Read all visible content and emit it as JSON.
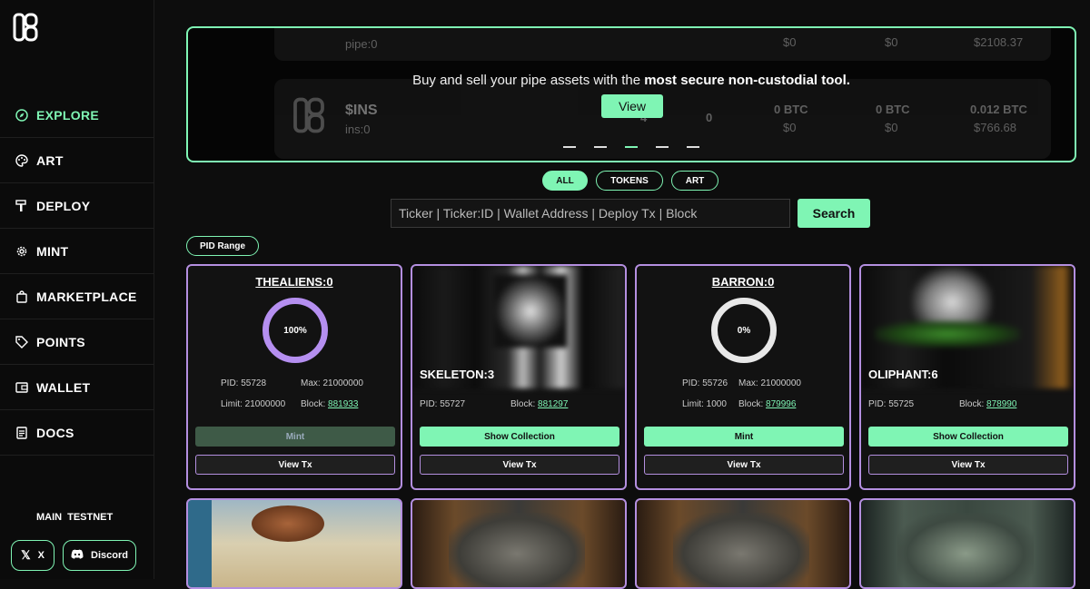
{
  "sidebar": {
    "items": [
      {
        "label": "EXPLORE",
        "icon": "compass-icon"
      },
      {
        "label": "ART",
        "icon": "palette-icon"
      },
      {
        "label": "DEPLOY",
        "icon": "hammer-icon"
      },
      {
        "label": "MINT",
        "icon": "gear-icon"
      },
      {
        "label": "MARKETPLACE",
        "icon": "shopping-bag-icon"
      },
      {
        "label": "POINTS",
        "icon": "tag-icon"
      },
      {
        "label": "WALLET",
        "icon": "wallet-icon"
      },
      {
        "label": "DOCS",
        "icon": "document-icon"
      }
    ],
    "network": {
      "main": "MAIN",
      "testnet": "TESTNET"
    },
    "social": {
      "x_label": "X",
      "discord_label": "Discord"
    }
  },
  "hero": {
    "text_plain": "Buy and sell your pipe assets with the ",
    "text_bold": "most secure non-custodial tool.",
    "button": "View",
    "ghost_top": {
      "sub": "pipe:0",
      "c1": "$0",
      "c2": "$0",
      "c3": "$2108.37"
    },
    "ghost_bottom": {
      "ticker": "$INS",
      "sub": "ins:0",
      "holders": "4",
      "count": "0",
      "v1": "0 BTC",
      "v1s": "$0",
      "v2": "0 BTC",
      "v2s": "$0",
      "v3": "0.012 BTC",
      "v3s": "$766.68"
    },
    "active_dot": 2,
    "dot_count": 5
  },
  "filters": {
    "all": "ALL",
    "tokens": "TOKENS",
    "art": "ART",
    "active": "ALL"
  },
  "search": {
    "placeholder": "Ticker | Ticker:ID | Wallet Address | Deploy Tx | Block",
    "button": "Search"
  },
  "pid_range": "PID Range",
  "cards": [
    {
      "name": "THEALIENS:0",
      "progress": "100%",
      "pid": "PID: 55728",
      "max": "Max: 21000000",
      "limit": "Limit: 21000000",
      "block_label": "Block:",
      "block": "881933",
      "mint": "Mint",
      "tx": "View Tx"
    },
    {
      "name": "SKELETON:3",
      "pid": "PID: 55727",
      "block_label": "Block:",
      "block": "881297",
      "action": "Show Collection",
      "tx": "View Tx"
    },
    {
      "name": "BARRON:0",
      "progress": "0%",
      "pid": "PID: 55726",
      "max": "Max: 21000000",
      "limit": "Limit: 1000",
      "block_label": "Block:",
      "block": "879996",
      "mint": "Mint",
      "tx": "View Tx"
    },
    {
      "name": "OLIPHANT:6",
      "pid": "PID: 55725",
      "block_label": "Block:",
      "block": "878990",
      "action": "Show Collection",
      "tx": "View Tx"
    }
  ],
  "colors": {
    "accent": "#7ff5b4",
    "card_border": "#b48fe0",
    "background": "#0d0d0d"
  }
}
